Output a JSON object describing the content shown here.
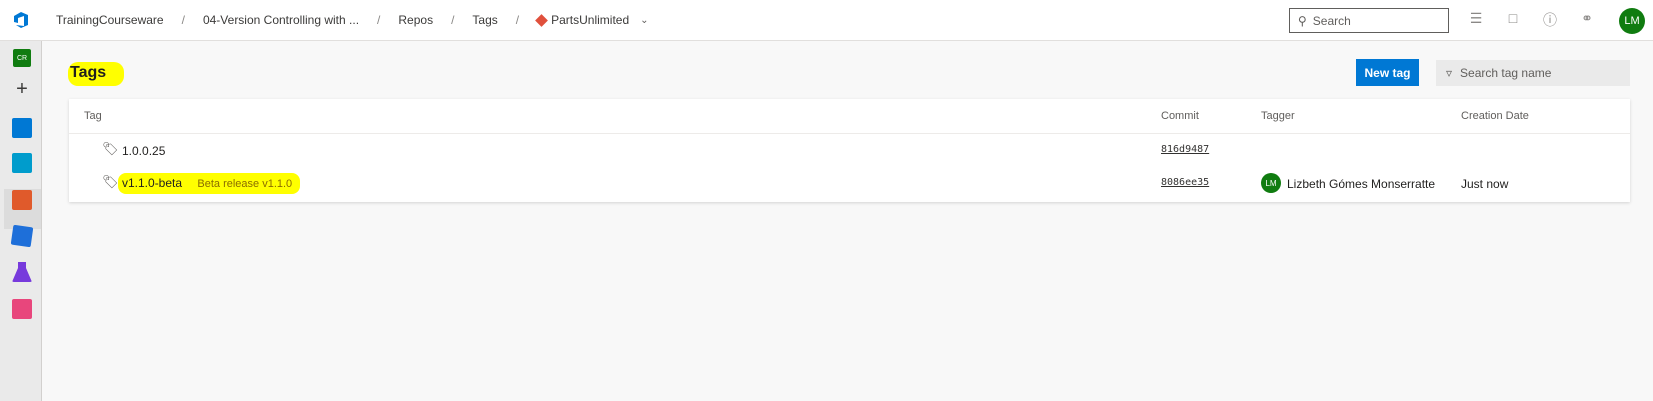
{
  "breadcrumbs": {
    "org": "TrainingCourseware",
    "project": "04-Version Controlling with ...",
    "section": "Repos",
    "page": "Tags",
    "repo": "PartsUnlimited"
  },
  "search": {
    "placeholder": "Search"
  },
  "user": {
    "initials": "LM"
  },
  "rail": {
    "project_initials": "CR"
  },
  "page": {
    "title": "Tags",
    "new_tag_label": "New tag",
    "filter_placeholder": "Search tag name"
  },
  "table": {
    "headers": {
      "tag": "Tag",
      "commit": "Commit",
      "tagger": "Tagger",
      "date": "Creation Date"
    },
    "rows": [
      {
        "tag": "1.0.0.25",
        "message": "",
        "commit": "816d9487",
        "tagger_initials": "",
        "tagger": "",
        "date": ""
      },
      {
        "tag": "v1.1.0-beta",
        "message": "Beta release v1.1.0",
        "commit": "8086ee35",
        "tagger_initials": "LM",
        "tagger": "Lizbeth Gómes Monserratte",
        "date": "Just now"
      }
    ]
  },
  "colors": {
    "accent": "#0078d4",
    "highlight": "#ffff00",
    "avatar": "#107c10"
  }
}
